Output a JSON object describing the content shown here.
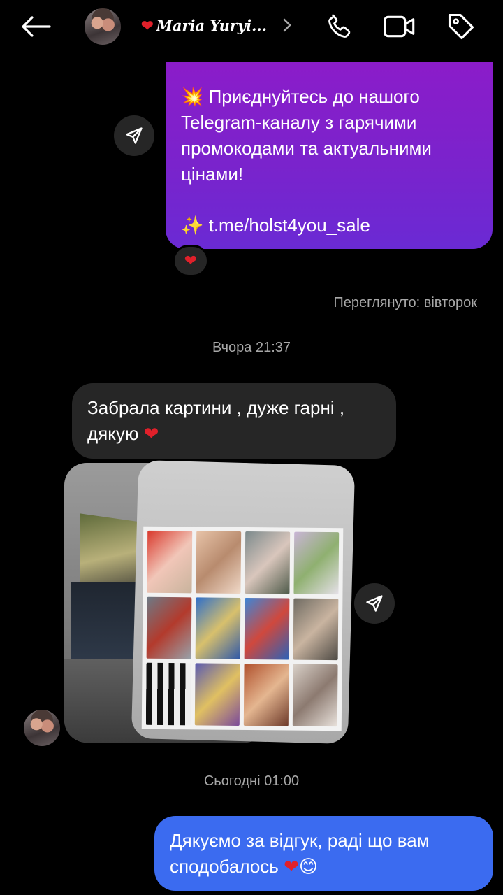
{
  "header": {
    "contact_name": "Maria Yuryi...",
    "name_prefix_icon": "red-heart-emoji",
    "icons": [
      "back-arrow-icon",
      "chevron-right-icon",
      "phone-icon",
      "video-camera-icon",
      "tag-icon"
    ]
  },
  "messages": {
    "promo": {
      "line1": "💥 Приєднуйтесь до нашого",
      "line2": "Telegram-каналу з гарячими",
      "line3": "промокодами та актуальними",
      "line4": "цінами!",
      "link": "✨ t.me/holst4you_sale",
      "reaction": "❤"
    },
    "seen_status": "Переглянуто: вівторок",
    "timestamp_1": "Вчора 21:37",
    "incoming": {
      "line1": "Забрала картини , дуже гарні ,",
      "line2": "дякую",
      "emoji": "❤"
    },
    "timestamp_2": "Сьогодні 01:00",
    "outgoing": {
      "line1": "Дякуємо за відгук, раді що вам",
      "line2": "сподобалось",
      "emoji_heart": "❤",
      "emoji_smile": "😊"
    }
  },
  "colors": {
    "background": "#000000",
    "promo_bubble_top": "#8b1cc9",
    "promo_bubble_bottom": "#6a2ad4",
    "incoming_bubble": "#262626",
    "outgoing_bubble": "#3b6bf0",
    "meta_text": "#a8a8a8",
    "heart": "#e0202a"
  }
}
